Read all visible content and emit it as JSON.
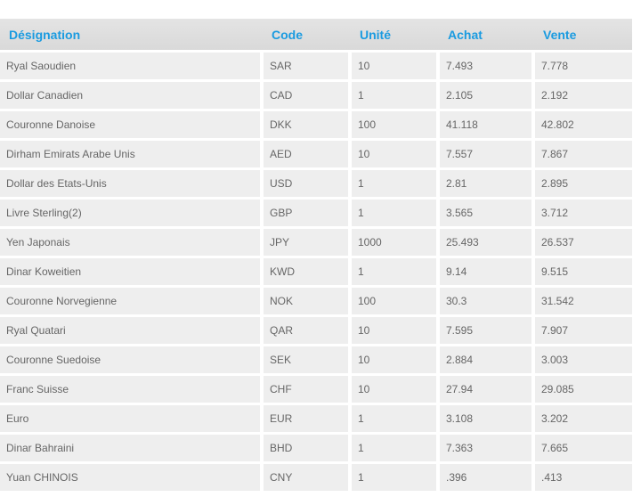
{
  "table": {
    "headers": [
      "Désignation",
      "Code",
      "Unité",
      "Achat",
      "Vente"
    ],
    "rows": [
      [
        "Ryal Saoudien",
        "SAR",
        "10",
        "7.493",
        "7.778"
      ],
      [
        "Dollar Canadien",
        "CAD",
        "1",
        "2.105",
        "2.192"
      ],
      [
        "Couronne Danoise",
        "DKK",
        "100",
        "41.118",
        "42.802"
      ],
      [
        "Dirham Emirats Arabe Unis",
        "AED",
        "10",
        "7.557",
        "7.867"
      ],
      [
        "Dollar des Etats-Unis",
        "USD",
        "1",
        "2.81",
        "2.895"
      ],
      [
        "Livre Sterling(2)",
        "GBP",
        "1",
        "3.565",
        "3.712"
      ],
      [
        "Yen Japonais",
        "JPY",
        "1000",
        "25.493",
        "26.537"
      ],
      [
        "Dinar Koweitien",
        "KWD",
        "1",
        "9.14",
        "9.515"
      ],
      [
        "Couronne Norvegienne",
        "NOK",
        "100",
        "30.3",
        "31.542"
      ],
      [
        "Ryal Quatari",
        "QAR",
        "10",
        "7.595",
        "7.907"
      ],
      [
        "Couronne Suedoise",
        "SEK",
        "10",
        "2.884",
        "3.003"
      ],
      [
        "Franc Suisse",
        "CHF",
        "10",
        "27.94",
        "29.085"
      ],
      [
        "Euro",
        "EUR",
        "1",
        "3.108",
        "3.202"
      ],
      [
        "Dinar Bahraini",
        "BHD",
        "1",
        "7.363",
        "7.665"
      ],
      [
        "Yuan CHINOIS",
        "CNY",
        "1",
        ".396",
        ".413"
      ]
    ]
  },
  "colors": {
    "header_text": "#1a9be0",
    "header_bg": "#dedede",
    "cell_bg": "#eeeeee",
    "cell_text": "#666666"
  }
}
